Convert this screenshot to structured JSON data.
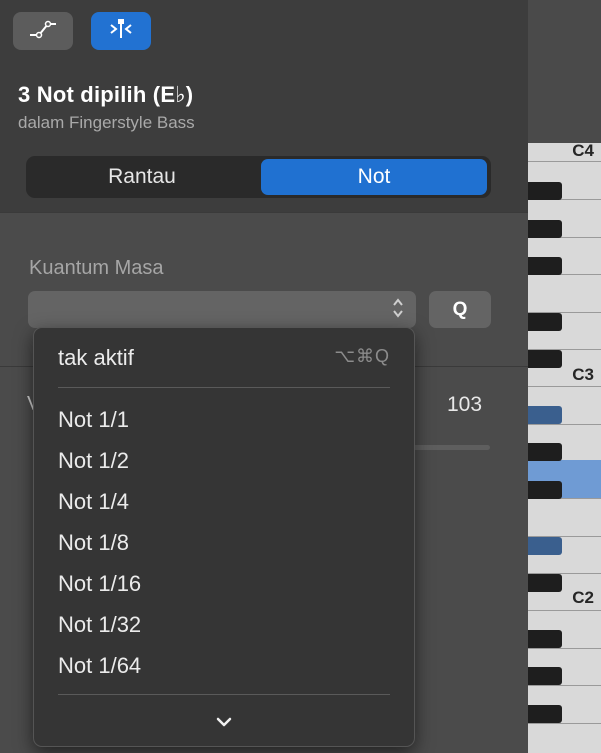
{
  "toolbar": {
    "automation_icon": "automation-curve-icon",
    "split_icon": "split-notes-icon",
    "colors": {
      "active": "#2272d2",
      "inactive": "#5c5c5c"
    }
  },
  "header": {
    "title": "3 Not dipilih (E♭)",
    "subtitle": "dalam Fingerstyle Bass"
  },
  "segmented": {
    "items": [
      "Rantau",
      "Not"
    ],
    "selected": "Not"
  },
  "quantize": {
    "label": "Kuantum Masa",
    "selected_value": "",
    "q_button": "Q"
  },
  "background": {
    "value": "103",
    "label_fragment": "V"
  },
  "dropdown_menu": {
    "off_item": "tak aktif",
    "off_shortcut": "⌥⌘Q",
    "items": [
      "Not 1/1",
      "Not 1/2",
      "Not 1/4",
      "Not 1/8",
      "Not 1/16",
      "Not 1/32",
      "Not 1/64"
    ],
    "more_icon": "chevron-down-icon"
  },
  "piano": {
    "labels": [
      "C4",
      "C3",
      "C2"
    ],
    "highlight_color": "#6f9bd4"
  }
}
